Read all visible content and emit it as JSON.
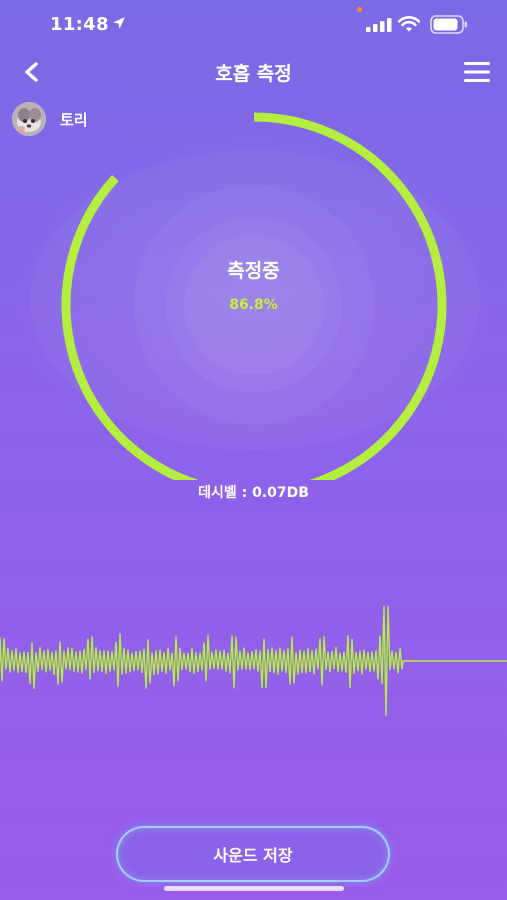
{
  "status_bar": {
    "time": "11:48",
    "icons": [
      "location-arrow-icon",
      "signal-icon",
      "wifi-icon",
      "battery-icon"
    ]
  },
  "nav": {
    "title": "호흡 측정",
    "back_icon": "chevron-left-icon",
    "menu_icon": "hamburger-menu-icon"
  },
  "user": {
    "name": "토리"
  },
  "gauge": {
    "label": "측정중",
    "value_text": "86.8%",
    "progress": 0.868
  },
  "decibel": {
    "text": "데시벨 : 0.07DB"
  },
  "save_button": {
    "label": "사운드 저장"
  },
  "colors": {
    "accent": "#b4ee3f",
    "background_top": "#7b6ae6",
    "background_bottom": "#9a5cea"
  }
}
